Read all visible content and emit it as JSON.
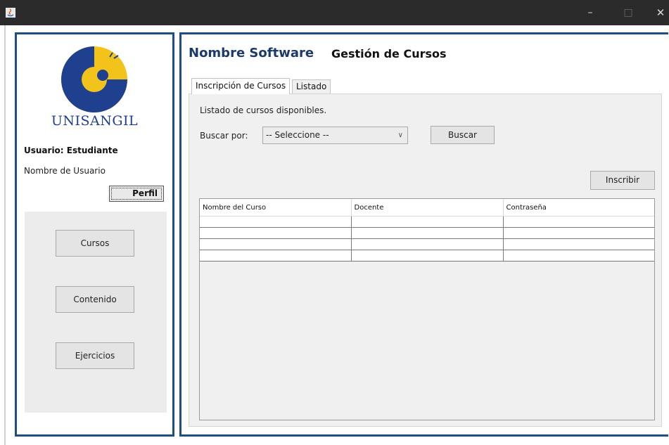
{
  "window": {
    "min_glyph": "–",
    "max_glyph": "□",
    "close_glyph": "✕"
  },
  "sidebar": {
    "brand": "UNISANGIL",
    "user_role": "Usuario: Estudiante",
    "user_name": "Nombre de Usuario",
    "profile_button": "Perfil",
    "nav": [
      "Cursos",
      "Contenido",
      "Ejercicios"
    ]
  },
  "header": {
    "software_name": "Nombre Software",
    "section_title": "Gestión de Cursos"
  },
  "tabs": [
    "Inscripción de Cursos",
    "Listado"
  ],
  "content": {
    "subtitle": "Listado de cursos disponibles.",
    "search_label": "Buscar por:",
    "select_value": "-- Seleccione --",
    "search_button": "Buscar",
    "enroll_button": "Inscribir"
  },
  "table": {
    "columns": [
      "Nombre del Curso",
      "Docente",
      "Contraseña"
    ],
    "rows": [
      [
        "",
        "",
        ""
      ],
      [
        "",
        "",
        ""
      ],
      [
        "",
        "",
        ""
      ],
      [
        "",
        "",
        ""
      ]
    ]
  },
  "colors": {
    "accent_border": "#1e4f82",
    "brand_blue": "#1f3f8f",
    "logo_yellow": "#f2c31b"
  }
}
